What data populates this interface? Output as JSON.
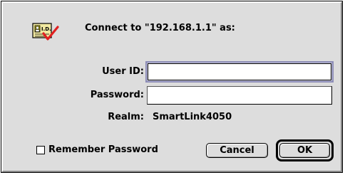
{
  "dialog": {
    "title": "Connect to \"192.168.1.1\" as:",
    "icon": "id-card-icon"
  },
  "form": {
    "userid_label": "User ID:",
    "userid_value": "",
    "password_label": "Password:",
    "password_value": "",
    "realm_label": "Realm:",
    "realm_value": "SmartLink4050"
  },
  "options": {
    "remember_label": "Remember Password",
    "remember_checked": false
  },
  "buttons": {
    "cancel_label": "Cancel",
    "ok_label": "OK"
  },
  "colors": {
    "dialog_bg": "#dddddd",
    "focus_ring": "#8c8cb6",
    "check_mark": "#e02020"
  }
}
